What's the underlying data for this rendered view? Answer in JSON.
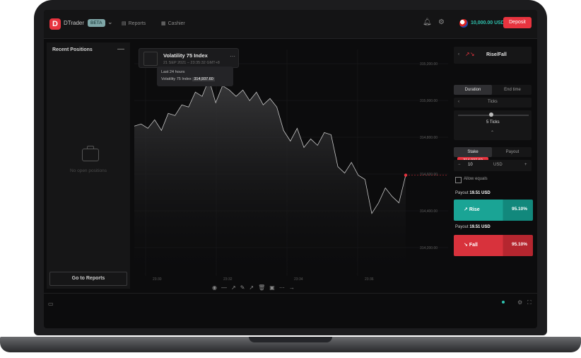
{
  "header": {
    "brand": "DTrader",
    "badge": "BETA",
    "nav": [
      {
        "label": "Reports",
        "icon": "reports-icon"
      },
      {
        "label": "Cashier",
        "icon": "cashier-icon"
      }
    ],
    "balance": "10,000.00 USD",
    "deposit_label": "Deposit"
  },
  "left_panel": {
    "title": "Recent Positions",
    "empty_text": "No open positions",
    "go_reports_label": "Go to Reports"
  },
  "chart": {
    "asset_title": "Volatility 75 Index",
    "asset_subtitle": "21 SEP 2021 – 23:35:32 GMT+8",
    "tooltip_line1": "Last 24 hours",
    "tooltip_line2_prefix": "Volatility 75 Index",
    "tooltip_line2_value": "314,937.60",
    "current_price_tag": "314,937.60",
    "y_ticks": [
      "315,200.00",
      "315,000.00",
      "314,800.00",
      "314,600.00",
      "314,400.00",
      "314,200.00"
    ],
    "x_ticks": [
      "23:30",
      "23:32",
      "23:34",
      "23:36"
    ],
    "colors": {
      "line": "#c6c6c6",
      "marker": "#e8343f",
      "area_top": "#3d3d3f"
    }
  },
  "chart_data": {
    "type": "area",
    "title": "Volatility 75 Index",
    "x": [
      0,
      1,
      2,
      3,
      4,
      5,
      6,
      7,
      8,
      9,
      10,
      11,
      12,
      13,
      14,
      15,
      16,
      17,
      18,
      19,
      20,
      21,
      22,
      23,
      24,
      25,
      26,
      27,
      28,
      29,
      30,
      31,
      32,
      33,
      34,
      35,
      36,
      37,
      38,
      39,
      40
    ],
    "values": [
      314890,
      314900,
      314880,
      314920,
      314870,
      314950,
      314940,
      314990,
      314980,
      315050,
      315030,
      315110,
      315000,
      315080,
      315060,
      315030,
      315060,
      315010,
      315050,
      314990,
      315020,
      314980,
      314870,
      314820,
      314880,
      314790,
      314830,
      314800,
      314860,
      314850,
      314700,
      314670,
      314720,
      314660,
      314640,
      314480,
      314530,
      314600,
      314560,
      314530,
      314660
    ],
    "ylim": [
      314200,
      315250
    ],
    "grid": true
  },
  "right_panel": {
    "asset_name": "Rise/Fall",
    "duration_tabs": [
      "Duration",
      "End time"
    ],
    "duration_unit": "Ticks",
    "ticks_label": "5 Ticks",
    "amount_tabs": [
      "Stake",
      "Payout"
    ],
    "stake_value": "10",
    "currency": "USD",
    "allow_equals": "Allow equals",
    "rise": {
      "payout_label": "Payout",
      "payout_value": "19.51 USD",
      "label": "Rise",
      "percent": "95.10%"
    },
    "fall": {
      "payout_label": "Payout",
      "payout_value": "19.51 USD",
      "label": "Fall",
      "percent": "95.10%"
    }
  }
}
